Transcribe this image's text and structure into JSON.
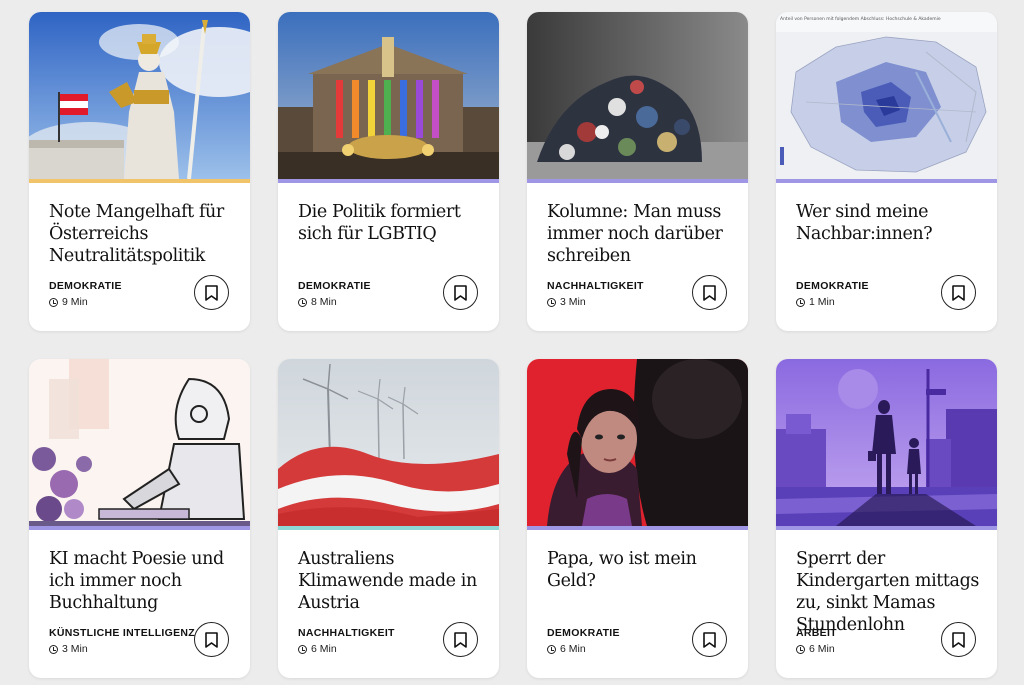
{
  "articles": [
    {
      "title": "Note Mangelhaft für Österreichs Neutralitätspolitik",
      "category": "DEMOKRATIE",
      "read_time": "9 Min",
      "accent": "#f1c46a",
      "image_icon": "athena-statue-image"
    },
    {
      "title": "Die Politik formiert sich für LGBTIQ",
      "category": "DEMOKRATIE",
      "read_time": "8 Min",
      "accent": "#9f96e6",
      "image_icon": "parliament-rainbow-image"
    },
    {
      "title": "Kolumne: Man muss immer noch darüber schreiben",
      "category": "NACHHALTIGKEIT",
      "read_time": "3 Min",
      "accent": "#9f96e6",
      "image_icon": "clothes-pile-image"
    },
    {
      "title": "Wer sind meine Nachbar:innen?",
      "category": "DEMOKRATIE",
      "read_time": "1 Min",
      "accent": "#9f96e6",
      "image_icon": "vienna-map-image"
    },
    {
      "title": "KI macht Poesie und ich immer noch Buchhaltung",
      "category": "KÜNSTLICHE INTELLIGENZ",
      "read_time": "3 Min",
      "accent": "#9f96e6",
      "image_icon": "robot-writing-image"
    },
    {
      "title": "Australiens Klimawende made in Austria",
      "category": "NACHHALTIGKEIT",
      "read_time": "6 Min",
      "accent": "#8fd6d6",
      "image_icon": "wind-turbines-flag-image"
    },
    {
      "title": "Papa, wo ist mein Geld?",
      "category": "DEMOKRATIE",
      "read_time": "6 Min",
      "accent": "#9f96e6",
      "image_icon": "girl-father-image"
    },
    {
      "title": "Sperrt der Kindergarten mittags zu, sinkt Mamas Stundenlohn",
      "category": "ARBEIT",
      "read_time": "6 Min",
      "accent": "#9f96e6",
      "image_icon": "mother-child-street-image"
    }
  ],
  "map_caption": "Anteil von Personen mit folgendem Abschluss: Hochschule & Akademie"
}
